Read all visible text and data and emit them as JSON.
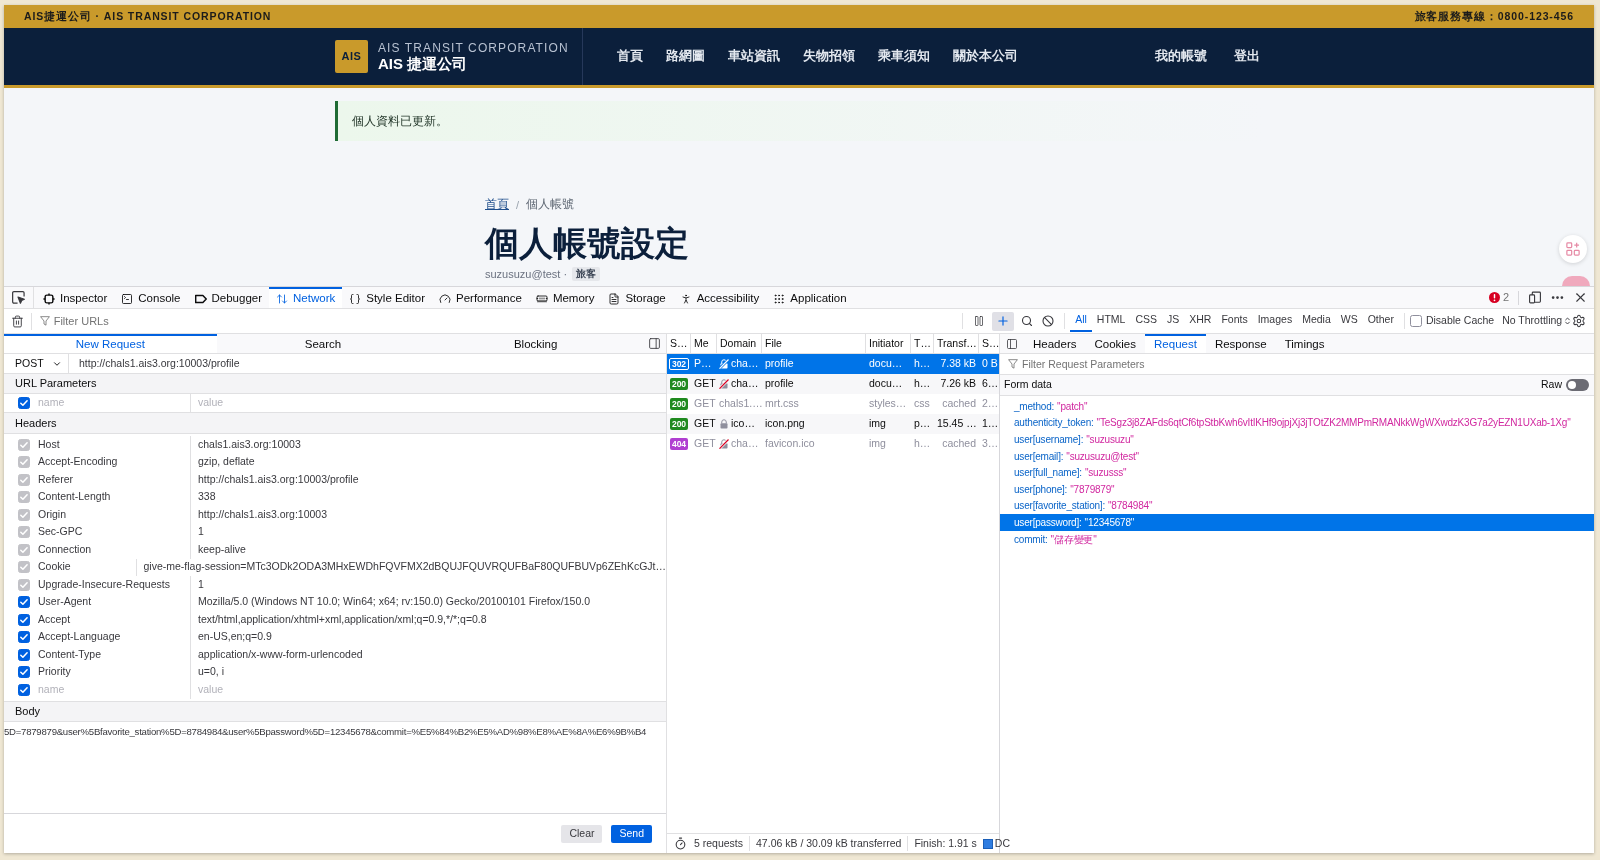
{
  "site": {
    "topbar": {
      "brand": "AIS捷運公司 · AIS TRANSIT CORPORATION",
      "hotline": "旅客服務專線：0800-123-456"
    },
    "header": {
      "logo": "AIS",
      "name_en": "AIS TRANSIT CORPORATION",
      "name_zh": "AIS 捷運公司",
      "nav": [
        "首頁",
        "路網圖",
        "車站資訊",
        "失物招領",
        "乘車須知",
        "關於本公司"
      ],
      "account": [
        "我的帳號",
        "登出"
      ]
    },
    "alert": "個人資料已更新。",
    "breadcrumb": {
      "items": [
        {
          "label": "首頁",
          "link": true
        },
        {
          "label": "個人帳號",
          "link": false
        }
      ],
      "separator": "/"
    },
    "title": "個人帳號設定",
    "email": "suzusuzu@test ·",
    "role": "旅客"
  },
  "devtools": {
    "tools": [
      {
        "label": "Inspector",
        "selected": false
      },
      {
        "label": "Console",
        "selected": false
      },
      {
        "label": "Debugger",
        "selected": false
      },
      {
        "label": "Network",
        "selected": true
      },
      {
        "label": "Style Editor",
        "selected": false
      },
      {
        "label": "Performance",
        "selected": false
      },
      {
        "label": "Memory",
        "selected": false
      },
      {
        "label": "Storage",
        "selected": false
      },
      {
        "label": "Accessibility",
        "selected": false
      },
      {
        "label": "Application",
        "selected": false
      }
    ],
    "error_count": "2",
    "url_filter": {
      "placeholder": "Filter URLs"
    },
    "new_request_active": true,
    "type_filters": [
      {
        "label": "All",
        "selected": true
      },
      {
        "label": "HTML",
        "selected": false
      },
      {
        "label": "CSS",
        "selected": false
      },
      {
        "label": "JS",
        "selected": false
      },
      {
        "label": "XHR",
        "selected": false
      },
      {
        "label": "Fonts",
        "selected": false
      },
      {
        "label": "Images",
        "selected": false
      },
      {
        "label": "Media",
        "selected": false
      },
      {
        "label": "WS",
        "selected": false
      },
      {
        "label": "Other",
        "selected": false
      }
    ],
    "disable_cache": {
      "label": "Disable Cache",
      "checked": false
    },
    "throttling": "No Throttling",
    "new_request": {
      "tabs": [
        {
          "label": "New Request",
          "selected": true
        },
        {
          "label": "Search",
          "selected": false
        },
        {
          "label": "Blocking",
          "selected": false
        }
      ],
      "method": "POST",
      "url": "http://chals1.ais3.org:10003/profile",
      "url_params": {
        "title": "URL Parameters",
        "new_param": {
          "checked": true,
          "name": {
            "placeholder": "name"
          },
          "value": {
            "placeholder": "value"
          }
        }
      },
      "headers_title": "Headers",
      "headers": [
        {
          "name": "Host",
          "value": "chals1.ais3.org:10003",
          "checked": true,
          "disabled": true
        },
        {
          "name": "Accept-Encoding",
          "value": "gzip, deflate",
          "checked": true,
          "disabled": true
        },
        {
          "name": "Referer",
          "value": "http://chals1.ais3.org:10003/profile",
          "checked": true,
          "disabled": true
        },
        {
          "name": "Content-Length",
          "value": "338",
          "checked": true,
          "disabled": true
        },
        {
          "name": "Origin",
          "value": "http://chals1.ais3.org:10003",
          "checked": true,
          "disabled": true
        },
        {
          "name": "Sec-GPC",
          "value": "1",
          "checked": true,
          "disabled": true
        },
        {
          "name": "Connection",
          "value": "keep-alive",
          "checked": true,
          "disabled": true
        },
        {
          "name": "Cookie",
          "value": "give-me-flag-session=MTc3ODk2ODA3MHxEWDhFQVFMX2dBQUJFQUVRQUFBaF80QUFBUVp6ZEhKcGJt…",
          "checked": true,
          "disabled": true
        },
        {
          "name": "Upgrade-Insecure-Requests",
          "value": "1",
          "checked": true,
          "disabled": true
        },
        {
          "name": "User-Agent",
          "value": "Mozilla/5.0 (Windows NT 10.0; Win64; x64; rv:150.0) Gecko/20100101 Firefox/150.0",
          "checked": true,
          "disabled": false
        },
        {
          "name": "Accept",
          "value": "text/html,application/xhtml+xml,application/xml;q=0.9,*/*;q=0.8",
          "checked": true,
          "disabled": false
        },
        {
          "name": "Accept-Language",
          "value": "en-US,en;q=0.9",
          "checked": true,
          "disabled": false
        },
        {
          "name": "Content-Type",
          "value": "application/x-www-form-urlencoded",
          "checked": true,
          "disabled": false
        },
        {
          "name": "Priority",
          "value": "u=0, i",
          "checked": true,
          "disabled": false
        }
      ],
      "new_header": {
        "checked": true,
        "name": {
          "placeholder": "name"
        },
        "value": {
          "placeholder": "value"
        }
      },
      "body_title": "Body",
      "body": "5D=7879879&user%5Bfavorite_station%5D=8784984&user%5Bpassword%5D=12345678&commit=%E5%84%B2%E5%AD%98%E8%AE%8A%E6%9B%B4",
      "buttons": [
        "Clear",
        "Send"
      ]
    },
    "requests": {
      "columns": [
        "S…",
        "Me",
        "Domain",
        "File",
        "Initiator",
        "T…",
        "Transf…",
        "S…"
      ],
      "rows": [
        {
          "status": "302",
          "kind": "outline",
          "color": "#ffffff",
          "method": "P…",
          "lock": true,
          "insecure": true,
          "domain": "cha…",
          "file": "profile",
          "initiator": "docu…",
          "type": "h…",
          "transferred": "7.38 kB",
          "size": "0 B",
          "selected": true,
          "from_cache": false
        },
        {
          "status": "200",
          "kind": "filled",
          "color": "#1f8a1f",
          "method": "GET",
          "lock": true,
          "insecure": true,
          "domain": "cha…",
          "file": "profile",
          "initiator": "docu…",
          "type": "h…",
          "transferred": "7.26 kB",
          "size": "6…",
          "selected": false,
          "from_cache": false
        },
        {
          "status": "200",
          "kind": "filled",
          "color": "#1f8a1f",
          "method": "GET",
          "lock": false,
          "insecure": false,
          "domain": "chals1.…",
          "file": "mrt.css",
          "initiator": "styles…",
          "type": "css",
          "transferred": "cached",
          "size": "2…",
          "selected": false,
          "from_cache": true
        },
        {
          "status": "200",
          "kind": "filled",
          "color": "#1f8a1f",
          "method": "GET",
          "lock": true,
          "insecure": false,
          "domain": "ico…",
          "file": "icon.png",
          "initiator": "img",
          "type": "p…",
          "transferred": "15.45 …",
          "size": "1…",
          "selected": false,
          "from_cache": false
        },
        {
          "status": "404",
          "kind": "filled",
          "color": "#b03fd1",
          "method": "GET",
          "lock": true,
          "insecure": true,
          "domain": "cha…",
          "file": "favicon.ico",
          "initiator": "img",
          "type": "h…",
          "transferred": "cached",
          "size": "3…",
          "selected": false,
          "from_cache": true
        }
      ]
    },
    "summary": {
      "requests": "5 requests",
      "transferred": "47.06 kB / 30.09 kB transferred",
      "finish": "Finish: 1.91 s",
      "dom_loaded": "DC"
    },
    "details": {
      "tabs": [
        {
          "label": "Headers",
          "selected": false
        },
        {
          "label": "Cookies",
          "selected": false
        },
        {
          "label": "Request",
          "selected": true
        },
        {
          "label": "Response",
          "selected": false
        },
        {
          "label": "Timings",
          "selected": false
        }
      ],
      "filter": {
        "placeholder": "Filter Request Parameters"
      },
      "section": "Form data",
      "raw": {
        "label": "Raw",
        "on": false
      },
      "params": [
        {
          "name": "_method:",
          "value": "\"patch\"",
          "selected": false
        },
        {
          "name": "authenticity_token:",
          "value": "\"TeSgz3j8ZAFds6qtCf6tpStbKwh6vItIKHf9ojpjXj3jTOtZK2MMPmRMANkkWgWXwdzK3G7a2yEZN1UXab-1Xg\"",
          "selected": false
        },
        {
          "name": "user[username]:",
          "value": "\"suzusuzu\"",
          "selected": false
        },
        {
          "name": "user[email]:",
          "value": "\"suzusuzu@test\"",
          "selected": false
        },
        {
          "name": "user[full_name]:",
          "value": "\"suzusss\"",
          "selected": false
        },
        {
          "name": "user[phone]:",
          "value": "\"7879879\"",
          "selected": false
        },
        {
          "name": "user[favorite_station]:",
          "value": "\"8784984\"",
          "selected": false
        },
        {
          "name": "user[password]:",
          "value": "\"12345678\"",
          "selected": true
        },
        {
          "name": "commit:",
          "value": "\"儲存變更\"",
          "selected": false
        }
      ]
    }
  }
}
